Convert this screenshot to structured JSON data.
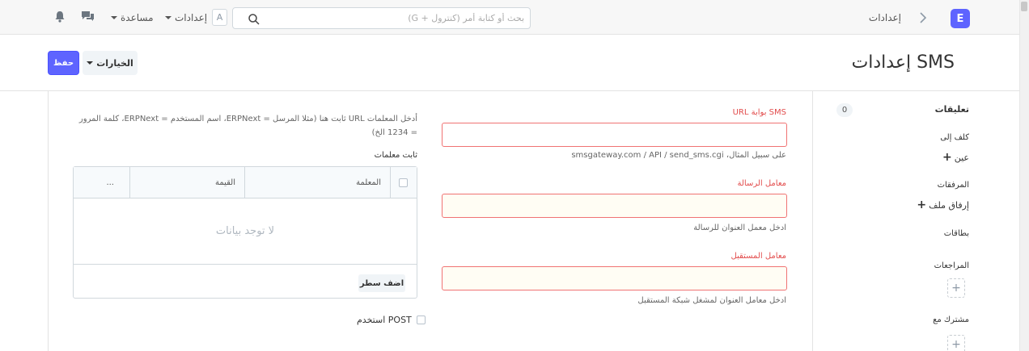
{
  "navbar": {
    "logo_letter": "E",
    "breadcrumb": "إعدادات",
    "search_placeholder": "بحث أو كتابة أمر (كنترول + G)",
    "avatar_letter": "A",
    "settings_label": "إعدادات",
    "help_label": "مساعدة"
  },
  "page": {
    "title": "SMS إعدادات",
    "save_label": "حفظ",
    "menu_label": "الخيارات"
  },
  "sidebar": {
    "comments_label": "تعليقات",
    "comments_count": "0",
    "assigned_to_label": "كلف إلى",
    "assign_link": "عين",
    "attachments_label": "المرفقات",
    "attach_link": "إرفاق ملف",
    "tags_label": "بطاقات",
    "reviews_label": "المراجعات",
    "shared_with_label": "مشترك مع"
  },
  "form": {
    "gateway_url_label": "SMS بوابة URL",
    "gateway_url_value": "",
    "gateway_url_desc": "على سبيل المثال، smsgateway.com / API / send_sms.cgi",
    "message_param_label": "معامل الرسالة",
    "message_param_value": "",
    "message_param_desc": "ادخل معمل العنوان للرسالة",
    "receiver_param_label": "معامل المستقبل",
    "receiver_param_value": "",
    "receiver_param_desc": "ادخل معامل العنوان لمشغل شبكة المستقبل",
    "static_params_desc": "أدخل المعلمات URL ثابت هنا (مثلا المرسل = ERPNext، اسم المستخدم = ERPNext، كلمة المرور = 1234 الخ)",
    "static_params_label": "ثابت معلمات",
    "table": {
      "col_param": "المعلمة",
      "col_value": "القيمة",
      "col_more": "...",
      "empty_text": "لا توجد بيانات",
      "add_row_label": "اضف سطر"
    },
    "use_post_label": "استخدم POST"
  }
}
